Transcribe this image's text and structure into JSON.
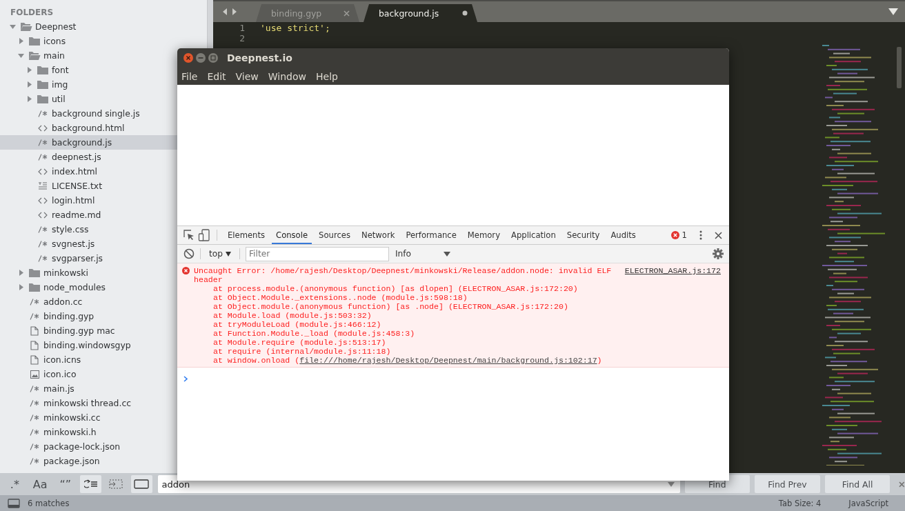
{
  "sidebar": {
    "heading": "FOLDERS",
    "items": [
      {
        "name": "Deepnest",
        "kind": "folder",
        "expanded": true,
        "selected": false,
        "children": [
          {
            "name": "icons",
            "kind": "folder",
            "expanded": false,
            "selected": false
          },
          {
            "name": "main",
            "kind": "folder",
            "expanded": true,
            "selected": false,
            "children": [
              {
                "name": "font",
                "kind": "folder",
                "expanded": false,
                "selected": false
              },
              {
                "name": "img",
                "kind": "folder",
                "expanded": false,
                "selected": false
              },
              {
                "name": "util",
                "kind": "folder",
                "expanded": false,
                "selected": false
              },
              {
                "name": "background single.js",
                "kind": "script",
                "selected": false
              },
              {
                "name": "background.html",
                "kind": "markup",
                "selected": false
              },
              {
                "name": "background.js",
                "kind": "script",
                "selected": true
              },
              {
                "name": "deepnest.js",
                "kind": "script",
                "selected": false
              },
              {
                "name": "index.html",
                "kind": "markup",
                "selected": false
              },
              {
                "name": "LICENSE.txt",
                "kind": "text",
                "selected": false
              },
              {
                "name": "login.html",
                "kind": "markup",
                "selected": false
              },
              {
                "name": "readme.md",
                "kind": "markup",
                "selected": false
              },
              {
                "name": "style.css",
                "kind": "script",
                "selected": false
              },
              {
                "name": "svgnest.js",
                "kind": "script",
                "selected": false
              },
              {
                "name": "svgparser.js",
                "kind": "script",
                "selected": false
              }
            ]
          },
          {
            "name": "minkowski",
            "kind": "folder",
            "expanded": false,
            "selected": false
          },
          {
            "name": "node_modules",
            "kind": "folder",
            "expanded": false,
            "selected": false
          },
          {
            "name": "addon.cc",
            "kind": "script",
            "selected": false
          },
          {
            "name": "binding.gyp",
            "kind": "script",
            "selected": false
          },
          {
            "name": "binding.gyp mac",
            "kind": "blank",
            "selected": false
          },
          {
            "name": "binding.windowsgyp",
            "kind": "blank",
            "selected": false
          },
          {
            "name": "icon.icns",
            "kind": "blank",
            "selected": false
          },
          {
            "name": "icon.ico",
            "kind": "image",
            "selected": false
          },
          {
            "name": "main.js",
            "kind": "script",
            "selected": false
          },
          {
            "name": "minkowski thread.cc",
            "kind": "script",
            "selected": false
          },
          {
            "name": "minkowski.cc",
            "kind": "script",
            "selected": false
          },
          {
            "name": "minkowski.h",
            "kind": "script",
            "selected": false
          },
          {
            "name": "package-lock.json",
            "kind": "script",
            "selected": false
          },
          {
            "name": "package.json",
            "kind": "script",
            "selected": false
          }
        ]
      }
    ]
  },
  "editor": {
    "tabs": [
      {
        "label": "binding.gyp",
        "selected": false,
        "modified": false
      },
      {
        "label": "background.js",
        "selected": true,
        "modified": true
      }
    ],
    "lines": [
      {
        "number": "1",
        "code": "'use strict';"
      },
      {
        "number": "2"
      }
    ]
  },
  "find_bar": {
    "toggles": [
      {
        "kind": "glyph",
        "label": ".*",
        "on": false
      },
      {
        "kind": "glyph",
        "label": "Aa",
        "on": false
      },
      {
        "kind": "glyph",
        "label": "“”",
        "on": false
      },
      {
        "kind": "wrap",
        "on": true
      },
      {
        "kind": "selection",
        "on": false
      },
      {
        "kind": "highlight",
        "on": true
      }
    ],
    "value": "addon",
    "buttons": [
      "Find",
      "Find Prev",
      "Find All"
    ]
  },
  "status_bar": {
    "matches": "6 matches",
    "tab_size": "Tab Size: 4",
    "syntax": "JavaScript"
  },
  "app_window": {
    "title": "Deepnest.io",
    "menu": [
      "File",
      "Edit",
      "View",
      "Window",
      "Help"
    ],
    "devtools": {
      "tabs": [
        {
          "label": "Elements",
          "selected": false
        },
        {
          "label": "Console",
          "selected": true
        },
        {
          "label": "Sources",
          "selected": false
        },
        {
          "label": "Network",
          "selected": false
        },
        {
          "label": "Performance",
          "selected": false
        },
        {
          "label": "Memory",
          "selected": false
        },
        {
          "label": "Application",
          "selected": false
        },
        {
          "label": "Security",
          "selected": false
        },
        {
          "label": "Audits",
          "selected": false
        }
      ],
      "error_count": "1",
      "context": "top",
      "filter_placeholder": "Filter",
      "level": "Info",
      "messages": [
        {
          "kind": "error",
          "text": "Uncaught Error: /home/rajesh/Desktop/Deepnest/minkowski/Release/addon.node: invalid ELF header",
          "source": "ELECTRON_ASAR.js:172",
          "stack": [
            {
              "text": "at process.module.(anonymous function) [as dlopen] (ELECTRON_ASAR.js:172:20)"
            },
            {
              "text": "at Object.Module._extensions..node (module.js:598:18)"
            },
            {
              "text": "at Object.module.(anonymous function) [as .node] (ELECTRON_ASAR.js:172:20)"
            },
            {
              "text": "at Module.load (module.js:503:32)"
            },
            {
              "text": "at tryModuleLoad (module.js:466:12)"
            },
            {
              "text": "at Function.Module._load (module.js:458:3)"
            },
            {
              "text": "at Module.require (module.js:513:17)"
            },
            {
              "text": "at require (internal/module.js:11:18)"
            },
            {
              "text": "at window.onload (",
              "link": "file:///home/rajesh/Desktop/Deepnest/main/background.js:102:17",
              "after": ")"
            }
          ]
        }
      ]
    }
  }
}
